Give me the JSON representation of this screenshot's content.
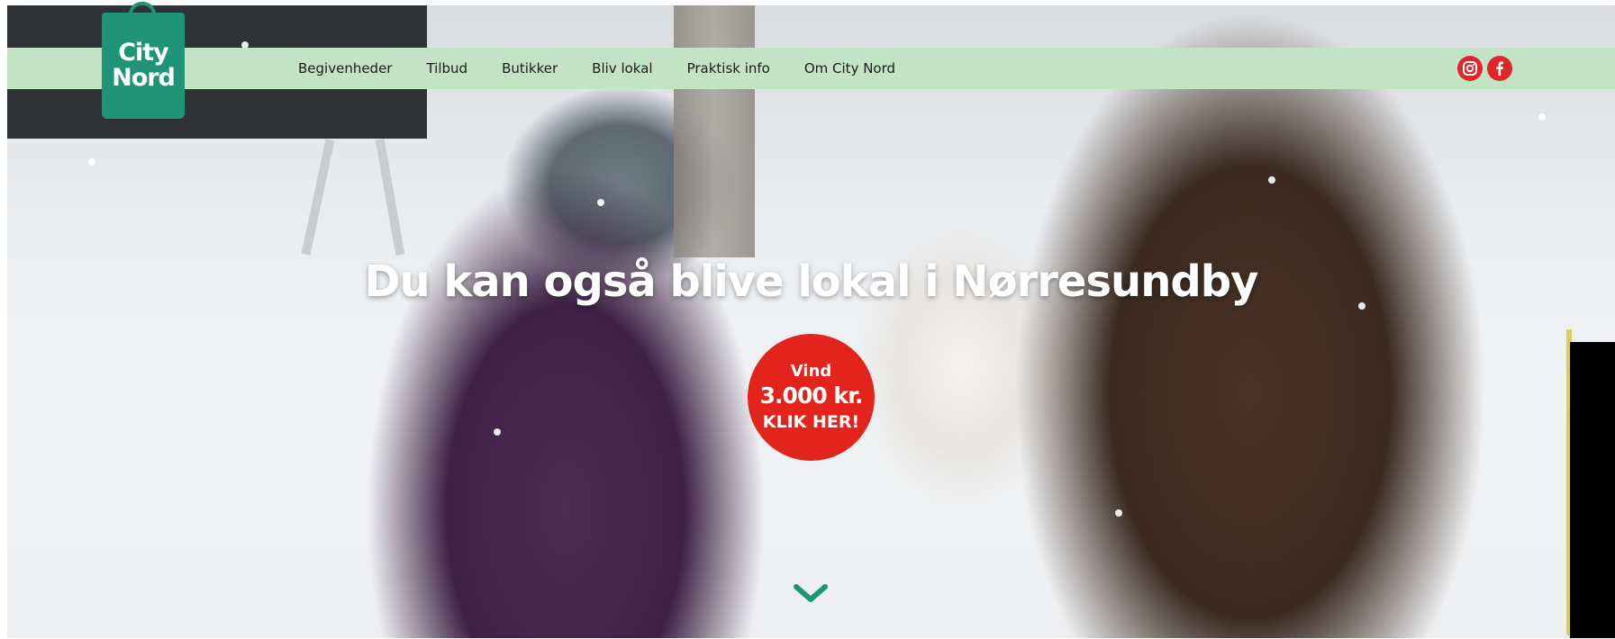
{
  "brand": {
    "logo_line1": "City",
    "logo_line2": "Nord",
    "logo_color": "#1f9477"
  },
  "nav": {
    "background": "#c2e3c4",
    "items": [
      {
        "label": "Begivenheder"
      },
      {
        "label": "Tilbud"
      },
      {
        "label": "Butikker"
      },
      {
        "label": "Bliv lokal"
      },
      {
        "label": "Praktisk info"
      },
      {
        "label": "Om City Nord"
      }
    ]
  },
  "social": {
    "color": "#e0262a",
    "icons": [
      "instagram-icon",
      "facebook-icon"
    ]
  },
  "hero": {
    "headline": "Du kan også blive lokal i Nørresundby",
    "cta": {
      "line1": "Vind",
      "line2": "3.000 kr.",
      "line3": "KLIK HER!",
      "color": "#e2241d"
    },
    "scroll_icon": "chevron-down-icon",
    "scroll_color": "#1f9477"
  }
}
